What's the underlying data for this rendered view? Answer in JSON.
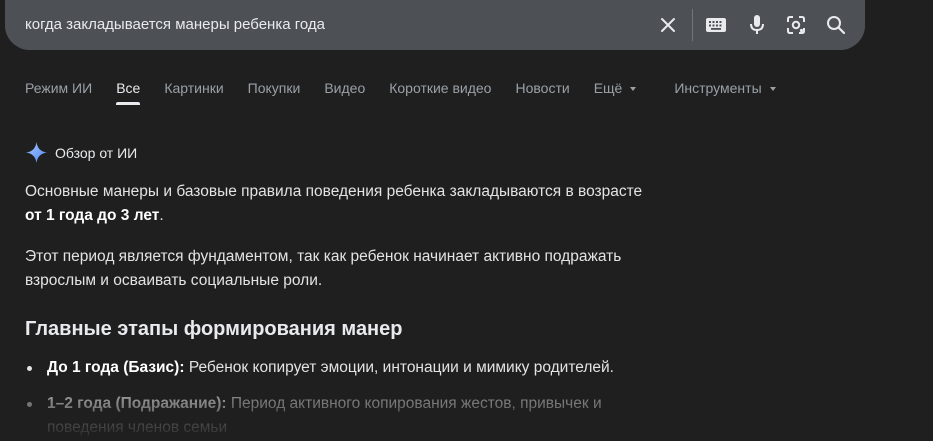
{
  "search": {
    "query": "когда закладывается манеры ребенка года"
  },
  "icons": {
    "clear": "close-icon",
    "keyboard": "keyboard-icon",
    "voice": "microphone-icon",
    "lens": "camera-lens-icon",
    "search": "search-icon"
  },
  "tabs": [
    {
      "label": "Режим ИИ"
    },
    {
      "label": "Все"
    },
    {
      "label": "Картинки"
    },
    {
      "label": "Покупки"
    },
    {
      "label": "Видео"
    },
    {
      "label": "Короткие видео"
    },
    {
      "label": "Новости"
    },
    {
      "label": "Ещё"
    },
    {
      "label": "Инструменты"
    }
  ],
  "ai_overview": {
    "label": "Обзор от ИИ",
    "p1_text": "Основные манеры и базовые правила поведения ребенка закладываются в возрасте ",
    "p1_bold": "от 1 года до 3 лет",
    "p1_end": ".",
    "p2": "Этот период является фундаментом, так как ребенок начинает активно подражать взрослым и осваивать социальные роли.",
    "heading": "Главные этапы формирования манер",
    "items": [
      {
        "title": "До 1 года (Базис):",
        "text": " Ребенок копирует эмоции, интонации и мимику родителей."
      },
      {
        "title": "1–2 года (Подражание):",
        "text": " Период активного копирования жестов, привычек и поведения членов семьи"
      }
    ]
  },
  "colors": {
    "background": "#1f1f1f",
    "search_bar": "#4d5156",
    "sparkle": "#8ab4f8"
  }
}
